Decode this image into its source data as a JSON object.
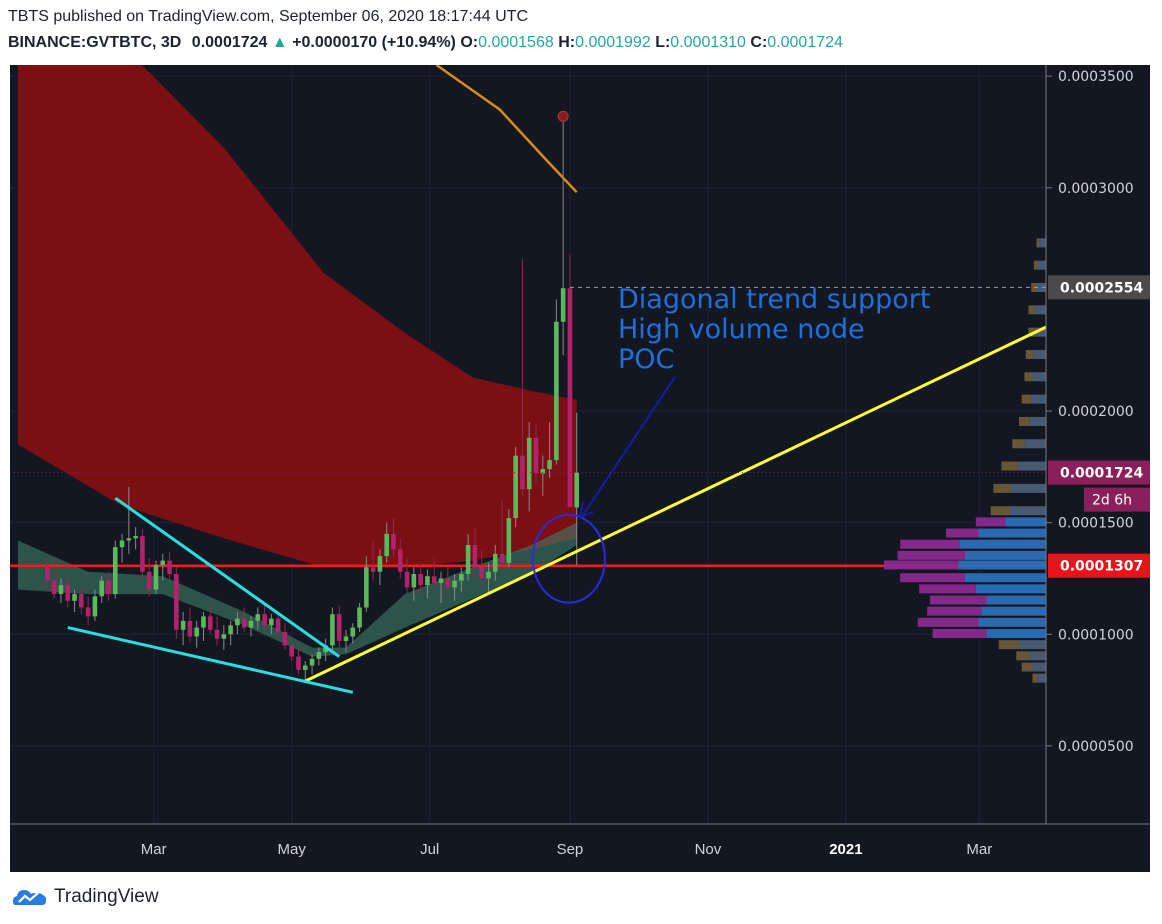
{
  "header": {
    "publisher_line": "TBTS published on TradingView.com, September 06, 2020 18:17:44 UTC",
    "symbol": "BINANCE:GVTBTC, 3D",
    "last": "0.0001724",
    "change": "+0.0000170 (+10.94%)",
    "open_label": "O:",
    "open": "0.0001568",
    "high_label": "H:",
    "high": "0.0001992",
    "low_label": "L:",
    "low": "0.0001310",
    "close_label": "C:",
    "close": "0.0001724"
  },
  "chart_data": {
    "type": "candlestick",
    "symbol": "BINANCE:GVTBTC",
    "interval": "3D",
    "x_tick_labels": [
      "Mar",
      "May",
      "Jul",
      "Sep",
      "Nov",
      "2021",
      "Mar"
    ],
    "y_tick_labels": [
      "0.0003500",
      "0.0003000",
      "0.0002000",
      "0.0001500",
      "0.0001000",
      "0.0000500"
    ],
    "ylim": [
      1.5e-05,
      0.000355
    ],
    "grid": true,
    "price_labels": [
      {
        "text": "0.0002554",
        "value": 0.0002554,
        "color": "#4a4a4a"
      },
      {
        "text": "0.0001724",
        "value": 0.0001724,
        "color": "#8b1f5a"
      },
      {
        "text": "0.0001307",
        "value": 0.0001307,
        "color": "#e8141a"
      }
    ],
    "countdown_label": "2d 6h",
    "horizontal_line": {
      "value": 0.0001307,
      "color": "#ff1a1a"
    },
    "annotation": {
      "lines": [
        "Diagonal trend support",
        "High volume node",
        "POC"
      ],
      "color": "#1e6fd9"
    },
    "candles": [
      {
        "date": "2020-01-14",
        "o": 0.00013,
        "h": 0.000134,
        "l": 0.00012,
        "c": 0.000124
      },
      {
        "date": "2020-01-17",
        "o": 0.000124,
        "h": 0.000128,
        "l": 0.000116,
        "c": 0.000118
      },
      {
        "date": "2020-01-20",
        "o": 0.000118,
        "h": 0.000125,
        "l": 0.000114,
        "c": 0.000122
      },
      {
        "date": "2020-01-23",
        "o": 0.000122,
        "h": 0.000126,
        "l": 0.000112,
        "c": 0.000115
      },
      {
        "date": "2020-01-26",
        "o": 0.000115,
        "h": 0.00012,
        "l": 0.00011,
        "c": 0.000118
      },
      {
        "date": "2020-01-29",
        "o": 0.000118,
        "h": 0.000122,
        "l": 0.000109,
        "c": 0.000112
      },
      {
        "date": "2020-02-01",
        "o": 0.000112,
        "h": 0.000117,
        "l": 0.000104,
        "c": 0.000108
      },
      {
        "date": "2020-02-04",
        "o": 0.000108,
        "h": 0.00012,
        "l": 0.000106,
        "c": 0.000117
      },
      {
        "date": "2020-02-07",
        "o": 0.000117,
        "h": 0.000126,
        "l": 0.000114,
        "c": 0.000124
      },
      {
        "date": "2020-02-10",
        "o": 0.000124,
        "h": 0.000128,
        "l": 0.000115,
        "c": 0.000118
      },
      {
        "date": "2020-02-13",
        "o": 0.000118,
        "h": 0.000142,
        "l": 0.000116,
        "c": 0.000139
      },
      {
        "date": "2020-02-16",
        "o": 0.000139,
        "h": 0.000145,
        "l": 0.000132,
        "c": 0.000142
      },
      {
        "date": "2020-02-19",
        "o": 0.000142,
        "h": 0.000166,
        "l": 0.000136,
        "c": 0.000143
      },
      {
        "date": "2020-02-22",
        "o": 0.000143,
        "h": 0.000148,
        "l": 0.000138,
        "c": 0.000144
      },
      {
        "date": "2020-02-25",
        "o": 0.000144,
        "h": 0.000147,
        "l": 0.000125,
        "c": 0.000128
      },
      {
        "date": "2020-02-28",
        "o": 0.000128,
        "h": 0.000134,
        "l": 0.000117,
        "c": 0.00012
      },
      {
        "date": "2020-03-02",
        "o": 0.00012,
        "h": 0.000133,
        "l": 0.000118,
        "c": 0.000131
      },
      {
        "date": "2020-03-05",
        "o": 0.000131,
        "h": 0.000136,
        "l": 0.000124,
        "c": 0.000133
      },
      {
        "date": "2020-03-08",
        "o": 0.000133,
        "h": 0.000137,
        "l": 0.000125,
        "c": 0.000127
      },
      {
        "date": "2020-03-11",
        "o": 0.000127,
        "h": 0.00013,
        "l": 9.8e-05,
        "c": 0.000102
      },
      {
        "date": "2020-03-14",
        "o": 0.000102,
        "h": 0.00011,
        "l": 9.5e-05,
        "c": 0.000106
      },
      {
        "date": "2020-03-17",
        "o": 0.000106,
        "h": 0.000112,
        "l": 9.6e-05,
        "c": 9.9e-05
      },
      {
        "date": "2020-03-20",
        "o": 9.9e-05,
        "h": 0.000106,
        "l": 9.4e-05,
        "c": 0.000103
      },
      {
        "date": "2020-03-23",
        "o": 0.000103,
        "h": 0.00011,
        "l": 9.7e-05,
        "c": 0.000108
      },
      {
        "date": "2020-03-26",
        "o": 0.000108,
        "h": 0.000115,
        "l": 0.0001,
        "c": 0.000102
      },
      {
        "date": "2020-03-29",
        "o": 0.000102,
        "h": 0.000108,
        "l": 9.5e-05,
        "c": 9.8e-05
      },
      {
        "date": "2020-04-01",
        "o": 9.8e-05,
        "h": 0.000104,
        "l": 9.3e-05,
        "c": 0.0001
      },
      {
        "date": "2020-04-04",
        "o": 0.0001,
        "h": 0.000106,
        "l": 9.5e-05,
        "c": 0.000104
      },
      {
        "date": "2020-04-07",
        "o": 0.000104,
        "h": 0.00011,
        "l": 0.0001,
        "c": 0.000107
      },
      {
        "date": "2020-04-10",
        "o": 0.000107,
        "h": 0.000112,
        "l": 0.000101,
        "c": 0.000103
      },
      {
        "date": "2020-04-13",
        "o": 0.000103,
        "h": 0.000108,
        "l": 9.9e-05,
        "c": 0.000106
      },
      {
        "date": "2020-04-16",
        "o": 0.000106,
        "h": 0.000112,
        "l": 0.000102,
        "c": 0.000109
      },
      {
        "date": "2020-04-19",
        "o": 0.000109,
        "h": 0.000114,
        "l": 0.000102,
        "c": 0.000104
      },
      {
        "date": "2020-04-22",
        "o": 0.000104,
        "h": 0.000109,
        "l": 0.0001,
        "c": 0.000107
      },
      {
        "date": "2020-04-25",
        "o": 0.000107,
        "h": 0.00011,
        "l": 9.9e-05,
        "c": 0.000101
      },
      {
        "date": "2020-04-28",
        "o": 0.000101,
        "h": 0.000105,
        "l": 9.3e-05,
        "c": 9.5e-05
      },
      {
        "date": "2020-05-01",
        "o": 9.5e-05,
        "h": 9.9e-05,
        "l": 8.8e-05,
        "c": 9e-05
      },
      {
        "date": "2020-05-04",
        "o": 9e-05,
        "h": 9.4e-05,
        "l": 8.2e-05,
        "c": 8.4e-05
      },
      {
        "date": "2020-05-07",
        "o": 8.4e-05,
        "h": 8.8e-05,
        "l": 7.9e-05,
        "c": 8.6e-05
      },
      {
        "date": "2020-05-10",
        "o": 8.6e-05,
        "h": 9.1e-05,
        "l": 8.2e-05,
        "c": 8.9e-05
      },
      {
        "date": "2020-05-13",
        "o": 8.9e-05,
        "h": 9.4e-05,
        "l": 8.6e-05,
        "c": 9.2e-05
      },
      {
        "date": "2020-05-16",
        "o": 9.2e-05,
        "h": 9.8e-05,
        "l": 8.8e-05,
        "c": 9.5e-05
      },
      {
        "date": "2020-05-19",
        "o": 9.5e-05,
        "h": 0.000112,
        "l": 9.3e-05,
        "c": 0.000109
      },
      {
        "date": "2020-05-22",
        "o": 0.000109,
        "h": 0.000113,
        "l": 9.4e-05,
        "c": 9.7e-05
      },
      {
        "date": "2020-05-25",
        "o": 9.7e-05,
        "h": 0.000102,
        "l": 9.2e-05,
        "c": 9.9e-05
      },
      {
        "date": "2020-05-28",
        "o": 9.9e-05,
        "h": 0.000105,
        "l": 9.6e-05,
        "c": 0.000103
      },
      {
        "date": "2020-05-31",
        "o": 0.000103,
        "h": 0.000114,
        "l": 0.000101,
        "c": 0.000112
      },
      {
        "date": "2020-06-03",
        "o": 0.000112,
        "h": 0.000135,
        "l": 0.00011,
        "c": 0.00013
      },
      {
        "date": "2020-06-06",
        "o": 0.00013,
        "h": 0.000142,
        "l": 0.000124,
        "c": 0.000128
      },
      {
        "date": "2020-06-09",
        "o": 0.000128,
        "h": 0.000138,
        "l": 0.000122,
        "c": 0.000135
      },
      {
        "date": "2020-06-12",
        "o": 0.000135,
        "h": 0.00015,
        "l": 0.000132,
        "c": 0.000145
      },
      {
        "date": "2020-06-15",
        "o": 0.000145,
        "h": 0.000152,
        "l": 0.000135,
        "c": 0.000138
      },
      {
        "date": "2020-06-18",
        "o": 0.000138,
        "h": 0.000143,
        "l": 0.000125,
        "c": 0.000128
      },
      {
        "date": "2020-06-21",
        "o": 0.000128,
        "h": 0.000134,
        "l": 0.000118,
        "c": 0.000121
      },
      {
        "date": "2020-06-24",
        "o": 0.000121,
        "h": 0.00013,
        "l": 0.000115,
        "c": 0.000127
      },
      {
        "date": "2020-06-27",
        "o": 0.000127,
        "h": 0.000131,
        "l": 0.000118,
        "c": 0.000122
      },
      {
        "date": "2020-06-30",
        "o": 0.000122,
        "h": 0.000129,
        "l": 0.000116,
        "c": 0.000126
      },
      {
        "date": "2020-07-03",
        "o": 0.000126,
        "h": 0.000134,
        "l": 0.00012,
        "c": 0.000123
      },
      {
        "date": "2020-07-06",
        "o": 0.000123,
        "h": 0.000128,
        "l": 0.000114,
        "c": 0.000125
      },
      {
        "date": "2020-07-09",
        "o": 0.000125,
        "h": 0.00013,
        "l": 0.000118,
        "c": 0.000121
      },
      {
        "date": "2020-07-12",
        "o": 0.000121,
        "h": 0.000127,
        "l": 0.000115,
        "c": 0.000124
      },
      {
        "date": "2020-07-15",
        "o": 0.000124,
        "h": 0.00013,
        "l": 0.000119,
        "c": 0.000127
      },
      {
        "date": "2020-07-18",
        "o": 0.000127,
        "h": 0.000145,
        "l": 0.000124,
        "c": 0.00014
      },
      {
        "date": "2020-07-21",
        "o": 0.00014,
        "h": 0.000148,
        "l": 0.000126,
        "c": 0.00013
      },
      {
        "date": "2020-07-24",
        "o": 0.00013,
        "h": 0.000138,
        "l": 0.000122,
        "c": 0.000125
      },
      {
        "date": "2020-07-27",
        "o": 0.000125,
        "h": 0.000132,
        "l": 0.000118,
        "c": 0.000128
      },
      {
        "date": "2020-07-30",
        "o": 0.000128,
        "h": 0.00014,
        "l": 0.000124,
        "c": 0.000136
      },
      {
        "date": "2020-08-02",
        "o": 0.000136,
        "h": 0.00016,
        "l": 0.000128,
        "c": 0.000132
      },
      {
        "date": "2020-08-05",
        "o": 0.000132,
        "h": 0.000156,
        "l": 0.00013,
        "c": 0.000152
      },
      {
        "date": "2020-08-08",
        "o": 0.000152,
        "h": 0.000184,
        "l": 0.000148,
        "c": 0.00018
      },
      {
        "date": "2020-08-11",
        "o": 0.00018,
        "h": 0.000268,
        "l": 0.000162,
        "c": 0.000165
      },
      {
        "date": "2020-08-14",
        "o": 0.000165,
        "h": 0.000195,
        "l": 0.000155,
        "c": 0.000188
      },
      {
        "date": "2020-08-17",
        "o": 0.000188,
        "h": 0.000194,
        "l": 0.000168,
        "c": 0.000172
      },
      {
        "date": "2020-08-20",
        "o": 0.000172,
        "h": 0.00018,
        "l": 0.000162,
        "c": 0.000174
      },
      {
        "date": "2020-08-23",
        "o": 0.000174,
        "h": 0.000195,
        "l": 0.00017,
        "c": 0.000178
      },
      {
        "date": "2020-08-26",
        "o": 0.000178,
        "h": 0.00025,
        "l": 0.000176,
        "c": 0.00024
      },
      {
        "date": "2020-08-29",
        "o": 0.00024,
        "h": 0.000332,
        "l": 0.000225,
        "c": 0.000255
      },
      {
        "date": "2020-09-01",
        "o": 0.000255,
        "h": 0.00027,
        "l": 0.000158,
        "c": 0.000157
      },
      {
        "date": "2020-09-04",
        "o": 0.0001568,
        "h": 0.0001992,
        "l": 0.000131,
        "c": 0.0001724
      }
    ],
    "trendlines": [
      {
        "name": "Diagonal trend support",
        "color": "#ffff33",
        "from": {
          "date": "2020-05-07",
          "value": 7.9e-05
        },
        "to": {
          "date": "2021-04-23",
          "value": 0.000249
        }
      },
      {
        "name": "Falling wedge upper",
        "color": "#26e0e0",
        "from": {
          "date": "2020-02-13",
          "value": 0.000161
        },
        "to": {
          "date": "2020-05-22",
          "value": 9e-05
        }
      },
      {
        "name": "Falling wedge lower",
        "color": "#26e0e0",
        "from": {
          "date": "2020-01-23",
          "value": 0.000103
        },
        "to": {
          "date": "2020-05-28",
          "value": 7.4e-05
        }
      }
    ],
    "volume_profile": {
      "poc": 0.0001307,
      "rows": [
        {
          "price": 0.000275,
          "up": 0.05,
          "down": 0.02
        },
        {
          "price": 0.000265,
          "up": 0.06,
          "down": 0.03
        },
        {
          "price": 0.000255,
          "up": 0.07,
          "down": 0.04
        },
        {
          "price": 0.000245,
          "up": 0.08,
          "down": 0.05
        },
        {
          "price": 0.000235,
          "up": 0.08,
          "down": 0.05
        },
        {
          "price": 0.000225,
          "up": 0.09,
          "down": 0.06
        },
        {
          "price": 0.000215,
          "up": 0.1,
          "down": 0.06
        },
        {
          "price": 0.000205,
          "up": 0.11,
          "down": 0.07
        },
        {
          "price": 0.000195,
          "up": 0.12,
          "down": 0.08
        },
        {
          "price": 0.000185,
          "up": 0.16,
          "down": 0.09
        },
        {
          "price": 0.000175,
          "up": 0.21,
          "down": 0.12
        },
        {
          "price": 0.000165,
          "up": 0.26,
          "down": 0.13
        },
        {
          "price": 0.000155,
          "up": 0.27,
          "down": 0.14
        },
        {
          "price": 0.00015,
          "up": 0.3,
          "down": 0.22
        },
        {
          "price": 0.000145,
          "up": 0.5,
          "down": 0.24
        },
        {
          "price": 0.00014,
          "up": 0.64,
          "down": 0.44
        },
        {
          "price": 0.000135,
          "up": 0.6,
          "down": 0.5
        },
        {
          "price": 0.0001307,
          "up": 0.65,
          "down": 0.55
        },
        {
          "price": 0.000125,
          "up": 0.6,
          "down": 0.48
        },
        {
          "price": 0.00012,
          "up": 0.52,
          "down": 0.42
        },
        {
          "price": 0.000115,
          "up": 0.44,
          "down": 0.42
        },
        {
          "price": 0.00011,
          "up": 0.48,
          "down": 0.4
        },
        {
          "price": 0.000105,
          "up": 0.5,
          "down": 0.45
        },
        {
          "price": 0.0001,
          "up": 0.44,
          "down": 0.4
        },
        {
          "price": 9.5e-05,
          "up": 0.2,
          "down": 0.15
        },
        {
          "price": 9e-05,
          "up": 0.12,
          "down": 0.1
        },
        {
          "price": 8.5e-05,
          "up": 0.1,
          "down": 0.08
        },
        {
          "price": 8e-05,
          "up": 0.06,
          "down": 0.04
        }
      ]
    }
  },
  "footer": {
    "brand": "TradingView"
  }
}
